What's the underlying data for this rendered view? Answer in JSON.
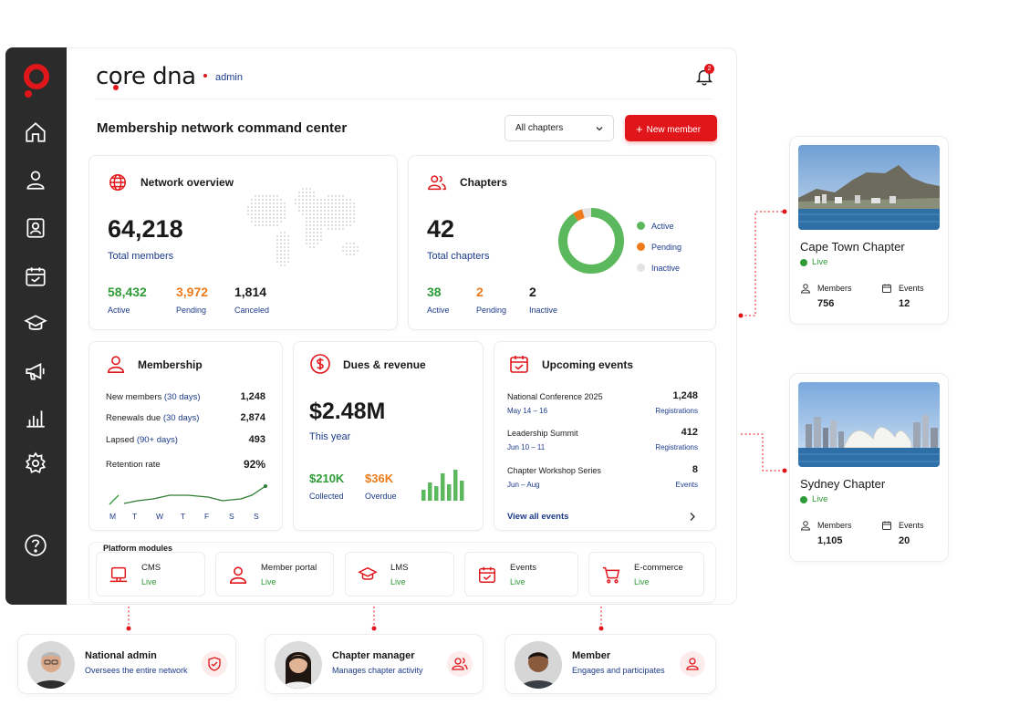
{
  "brand": {
    "name_pre": "c",
    "name_o": "o",
    "name_post": "re dna",
    "section": "admin"
  },
  "notifications": {
    "count": "2"
  },
  "header": {
    "title": "Membership network command center",
    "filter_value": "All chapters",
    "new_button": "New member"
  },
  "network": {
    "title": "Network overview",
    "total": "64,218",
    "total_label": "Total members",
    "stats": [
      {
        "value": "58,432",
        "label": "Active"
      },
      {
        "value": "3,972",
        "label": "Pending"
      },
      {
        "value": "1,814",
        "label": "Canceled"
      }
    ]
  },
  "chapters": {
    "title": "Chapters",
    "total": "42",
    "total_label": "Total chapters",
    "stats": [
      {
        "value": "38",
        "label": "Active"
      },
      {
        "value": "2",
        "label": "Pending"
      },
      {
        "value": "2",
        "label": "Inactive"
      }
    ],
    "legend": [
      "Active",
      "Pending",
      "Inactive"
    ],
    "colors": {
      "active": "#5cb85c",
      "pending": "#ee7a1a",
      "inactive": "#e4e4e4"
    },
    "donut": {
      "active_fraction": 0.905,
      "pending_fraction": 0.048
    }
  },
  "membership": {
    "title": "Membership",
    "rows": [
      {
        "label": "New members",
        "sub": "(30 days)",
        "value": "1,248"
      },
      {
        "label": "Renewals due",
        "sub": "(30 days)",
        "value": "2,874"
      },
      {
        "label": "Lapsed",
        "sub": "(90+ days)",
        "value": "493"
      }
    ],
    "retention_label": "Retention rate",
    "retention_value": "92%",
    "days": [
      "M",
      "T",
      "W",
      "T",
      "F",
      "S",
      "S"
    ]
  },
  "dues": {
    "title": "Dues & revenue",
    "total": "$2.48M",
    "period": "This year",
    "collected": "$210K",
    "collected_label": "Collected",
    "overdue": "$36K",
    "overdue_label": "Overdue"
  },
  "events": {
    "title": "Upcoming events",
    "items": [
      {
        "name": "National Conference 2025",
        "date": "May 14 – 16",
        "value": "1,248",
        "unit": "Registrations"
      },
      {
        "name": "Leadership Summit",
        "date": "Jun 10 – 11",
        "value": "412",
        "unit": "Registrations"
      },
      {
        "name": "Chapter Workshop Series",
        "date": "Jun – Aug",
        "value": "8",
        "unit": "Events"
      }
    ],
    "view_all": "View all events"
  },
  "modules": {
    "title": "Platform modules",
    "items": [
      {
        "name": "CMS",
        "status": "Live"
      },
      {
        "name": "Member portal",
        "status": "Live"
      },
      {
        "name": "LMS",
        "status": "Live"
      },
      {
        "name": "Events",
        "status": "Live"
      },
      {
        "name": "E-commerce",
        "status": "Live"
      }
    ]
  },
  "chapter_cards": [
    {
      "name": "Cape Town Chapter",
      "status": "Live",
      "members_label": "Members",
      "members": "756",
      "events_label": "Events",
      "events": "12"
    },
    {
      "name": "Sydney Chapter",
      "status": "Live",
      "members_label": "Members",
      "members": "1,105",
      "events_label": "Events",
      "events": "20"
    }
  ],
  "roles": [
    {
      "title": "National admin",
      "subtitle": "Oversees the entire network"
    },
    {
      "title": "Chapter manager",
      "subtitle": "Manages chapter activity"
    },
    {
      "title": "Member",
      "subtitle": "Engages and participates"
    }
  ],
  "icons": [
    "home-icon",
    "user-icon",
    "id-card-icon",
    "calendar-icon",
    "graduation-cap-icon",
    "megaphone-icon",
    "bar-chart-icon",
    "gear-icon",
    "help-icon",
    "bell-icon",
    "globe-icon",
    "users-icon",
    "dollar-icon",
    "calendar-check-icon",
    "monitor-icon",
    "cart-icon",
    "shield-icon"
  ],
  "accent": "#e0161b"
}
